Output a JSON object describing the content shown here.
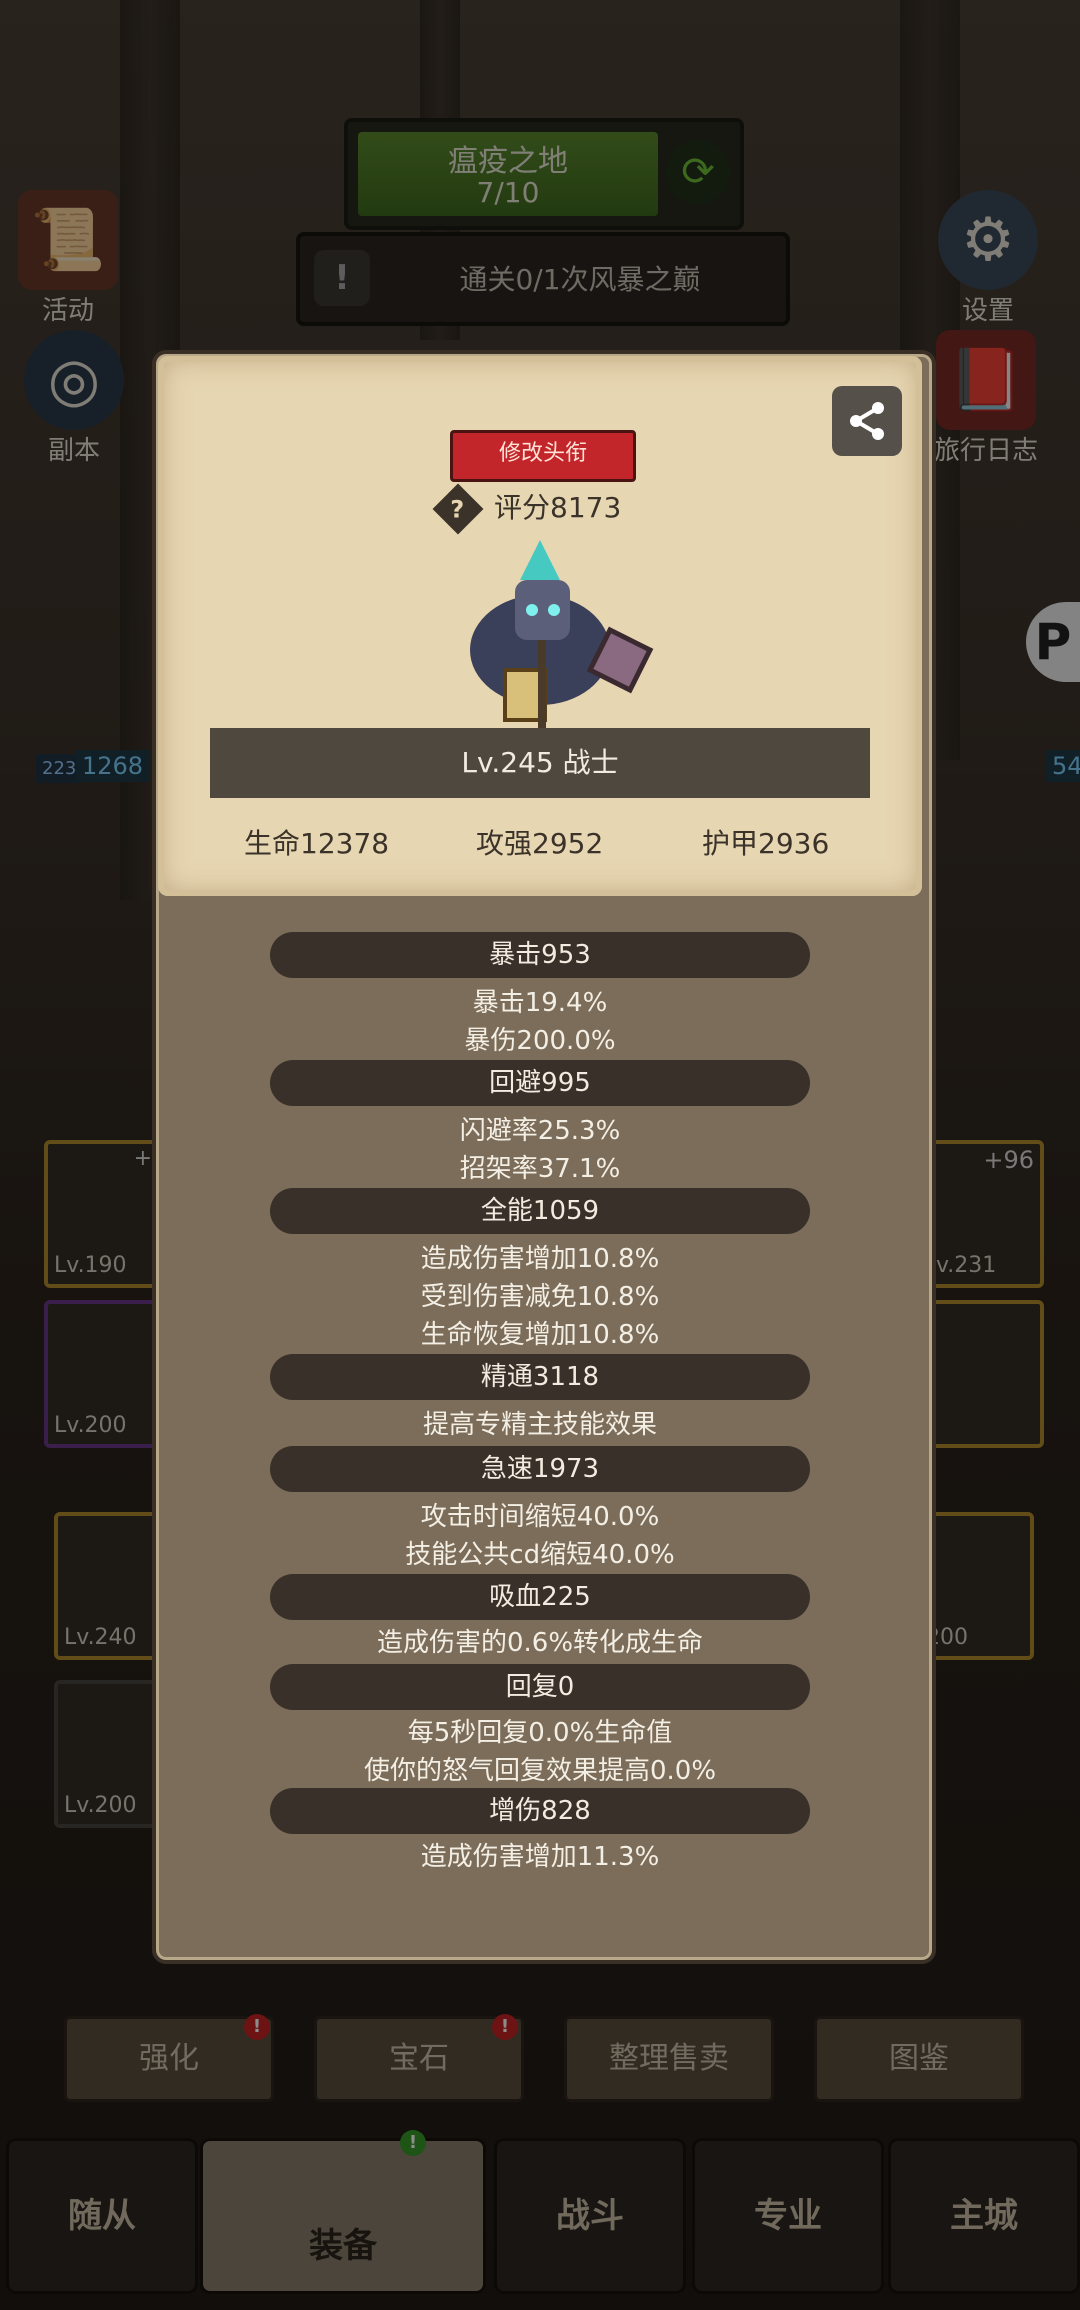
{
  "stage": {
    "name": "瘟疫之地",
    "progress": "7/10"
  },
  "quest": {
    "text": "通关0/1次风暴之巅"
  },
  "side_left": [
    {
      "label": "活动"
    },
    {
      "label": "副本"
    }
  ],
  "side_right": [
    {
      "label": "设置"
    },
    {
      "label": "旅行日志"
    }
  ],
  "bg_numbers": {
    "left_a": "223",
    "left_b": "1268",
    "right": "54"
  },
  "bg_slots": {
    "s1": "Lv.190",
    "s2": "Lv.200",
    "s3": "Lv.240",
    "s4": "Lv.200",
    "r1": "v.231",
    "r1_plus": "+96",
    "r3": "200",
    "l1_plus": "+"
  },
  "panel": {
    "title_button": "修改头衔",
    "score": "评分8173",
    "level_class": "Lv.245 战士",
    "main_stats": [
      "生命12378",
      "攻强2952",
      "护甲2936"
    ],
    "sections": [
      {
        "header": "暴击953",
        "lines": [
          "暴击19.4%",
          "暴伤200.0%"
        ]
      },
      {
        "header": "回避995",
        "lines": [
          "闪避率25.3%",
          "招架率37.1%"
        ]
      },
      {
        "header": "全能1059",
        "lines": [
          "造成伤害增加10.8%",
          "受到伤害减免10.8%",
          "生命恢复增加10.8%"
        ]
      },
      {
        "header": "精通3118",
        "lines": [
          "提高专精主技能效果"
        ]
      },
      {
        "header": "急速1973",
        "lines": [
          "攻击时间缩短40.0%",
          "技能公共cd缩短40.0%"
        ]
      },
      {
        "header": "吸血225",
        "lines": [
          "造成伤害的0.6%转化成生命"
        ]
      },
      {
        "header": "回复0",
        "lines": [
          "每5秒回复0.0%生命值",
          "使你的怒气回复效果提高0.0%"
        ]
      },
      {
        "header": "增伤828",
        "lines": [
          "造成伤害增加11.3%"
        ]
      }
    ]
  },
  "sub_buttons": [
    {
      "label": "强化"
    },
    {
      "label": "宝石"
    },
    {
      "label": "整理售卖"
    },
    {
      "label": "图鉴"
    }
  ],
  "bottom_tabs": [
    {
      "label": "随从"
    },
    {
      "label": "装备"
    },
    {
      "label": "战斗"
    },
    {
      "label": "专业"
    },
    {
      "label": "主城"
    }
  ],
  "icons": {
    "share": "share-icon",
    "refresh": "refresh-icon",
    "info": "question-icon",
    "alert": "exclamation-icon",
    "gear": "gear-icon"
  },
  "colors": {
    "stage_green": "#5c8a2e",
    "title_red": "#c3262a",
    "parchment": "#e7d6b2",
    "panel": "#7c6d5a"
  }
}
